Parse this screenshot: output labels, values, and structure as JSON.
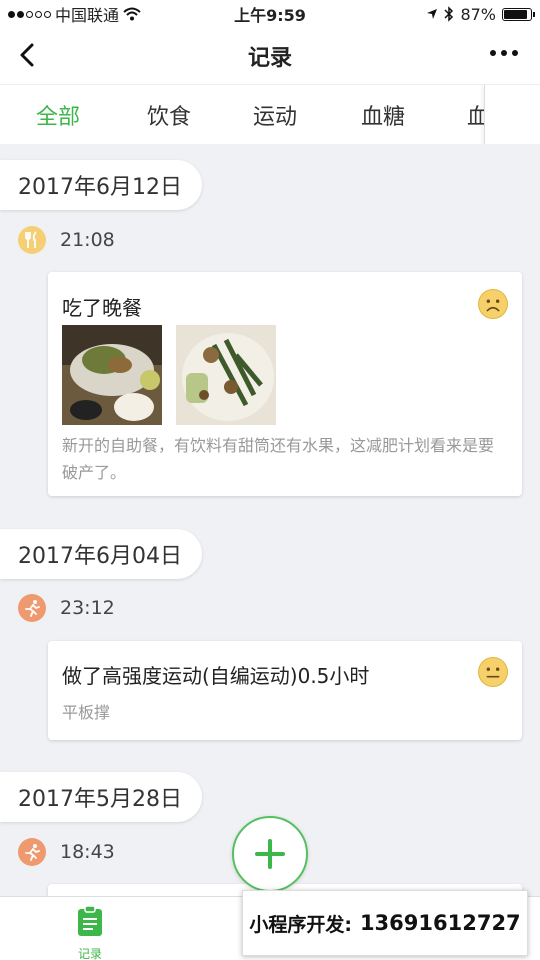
{
  "status_bar": {
    "carrier": "中国联通",
    "time": "上午9:59",
    "battery": "87%",
    "battery_level": 0.87
  },
  "nav": {
    "title": "记录"
  },
  "tabs": [
    {
      "label": "全部",
      "active": true
    },
    {
      "label": "饮食",
      "active": false
    },
    {
      "label": "运动",
      "active": false
    },
    {
      "label": "血糖",
      "active": false
    },
    {
      "label": "血",
      "active": false
    }
  ],
  "groups": [
    {
      "date": "2017年6月12日",
      "time": "21:08",
      "type_icon": "utensils-icon",
      "card": {
        "title": "吃了晚餐",
        "mood_icon": "sad-face-icon",
        "desc": "新开的自助餐，有饮料有甜筒还有水果，这减肥计划看来是要破产了。"
      }
    },
    {
      "date": "2017年6月04日",
      "time": "23:12",
      "type_icon": "running-icon",
      "card": {
        "title": "做了高强度运动(自编运动)0.5小时",
        "mood_icon": "neutral-face-icon",
        "desc": "平板撑"
      }
    },
    {
      "date": "2017年5月28日",
      "time": "18:43",
      "type_icon": "running-icon"
    }
  ],
  "bottom_tabs": [
    {
      "label": "记录",
      "active": true
    }
  ],
  "promo": {
    "label": "小程序开发:",
    "phone": "13691612727"
  },
  "colors": {
    "accent": "#3db64a",
    "food_icon_bg": "#f6ce74",
    "sport_icon_bg": "#ef9a6e",
    "page_bg": "#f0f1f4"
  }
}
